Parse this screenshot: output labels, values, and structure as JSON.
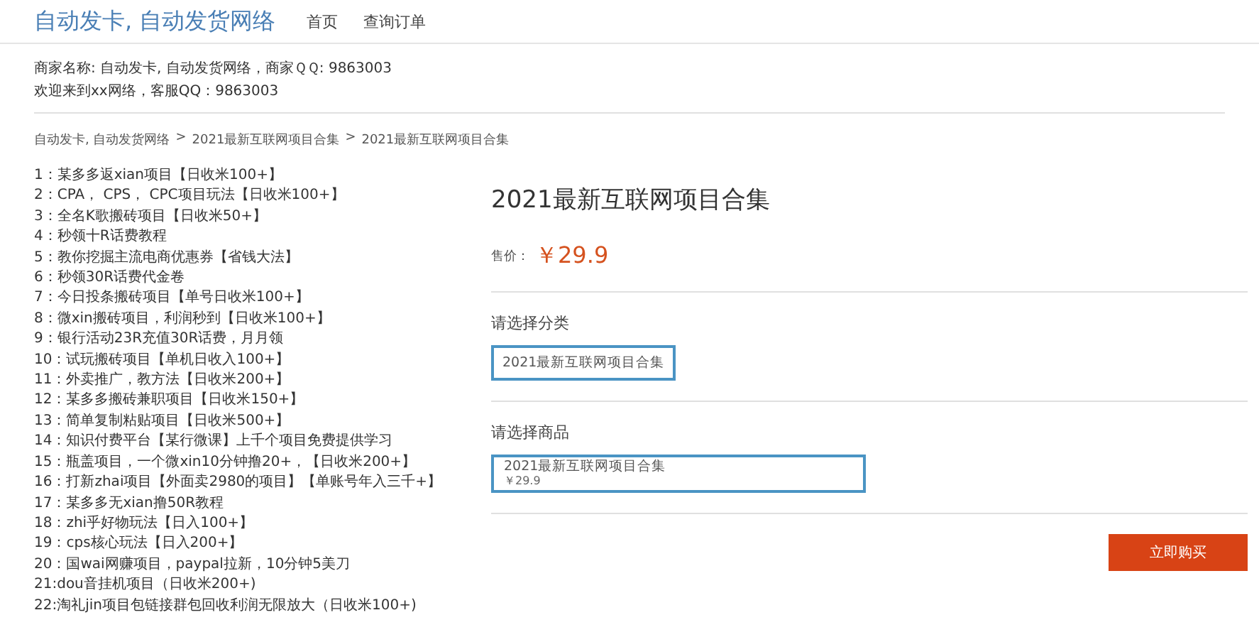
{
  "header": {
    "brand": "自动发卡, 自动发货网络",
    "nav": [
      {
        "label": "首页"
      },
      {
        "label": "查询订单"
      }
    ]
  },
  "info": [
    "商家名称: 自动发卡, 自动发货网络，商家ＱＱ: 9863003",
    "欢迎来到xx网络，客服QQ：9863003"
  ],
  "breadcrumb_separator": ">",
  "breadcrumb": [
    "自动发卡, 自动发货网络",
    "2021最新互联网项目合集",
    "2021最新互联网项目合集"
  ],
  "description": [
    "1：某多多返xian项目【日收米100+】",
    "2：CPA， CPS， CPC项目玩法【日收米100+】",
    "3：全名K歌搬砖项目【日收米50+】",
    "4：秒领十R话费教程",
    "5：教你挖掘主流电商优惠券【省钱大法】",
    "6：秒领30R话费代金卷",
    "7：今日投条搬砖项目【单号日收米100+】",
    "8：微xin搬砖项目，利润秒到【日收米100+】",
    "9：银行活动23R充值30R话费，月月领",
    "10：试玩搬砖项目【单机日收入100+】",
    "11：外卖推广，教方法【日收米200+】",
    "12：某多多搬砖兼职项目【日收米150+】",
    "13：简单复制粘贴项目【日收米500+】",
    "14：知识付费平台【某行微课】上千个项目免费提供学习",
    "15：瓶盖项目，一个微xin10分钟撸20+，【日收米200+】",
    "16：打新zhai项目【外面卖2980的项目】【单账号年入三千+】",
    "17：某多多无xian撸50R教程",
    "18：zhi乎好物玩法【日入100+】",
    "19：cps核心玩法【日入200+】",
    "20：国wai网赚项目，paypal拉新，10分钟5美刀",
    "21:dou音挂机项目（日收米200+)",
    "22:淘礼jin项目包链接群包回收利润无限放大（日收米100+)"
  ],
  "product": {
    "title": "2021最新互联网项目合集",
    "price_label": "售价：",
    "price": "￥29.9",
    "category": {
      "label": "请选择分类",
      "options": [
        {
          "name": "2021最新互联网项目合集",
          "selected": true
        }
      ]
    },
    "goods": {
      "label": "请选择商品",
      "options": [
        {
          "name": "2021最新互联网项目合集",
          "price": "￥29.9",
          "selected": true
        }
      ]
    },
    "buy_button": "立即购买"
  }
}
